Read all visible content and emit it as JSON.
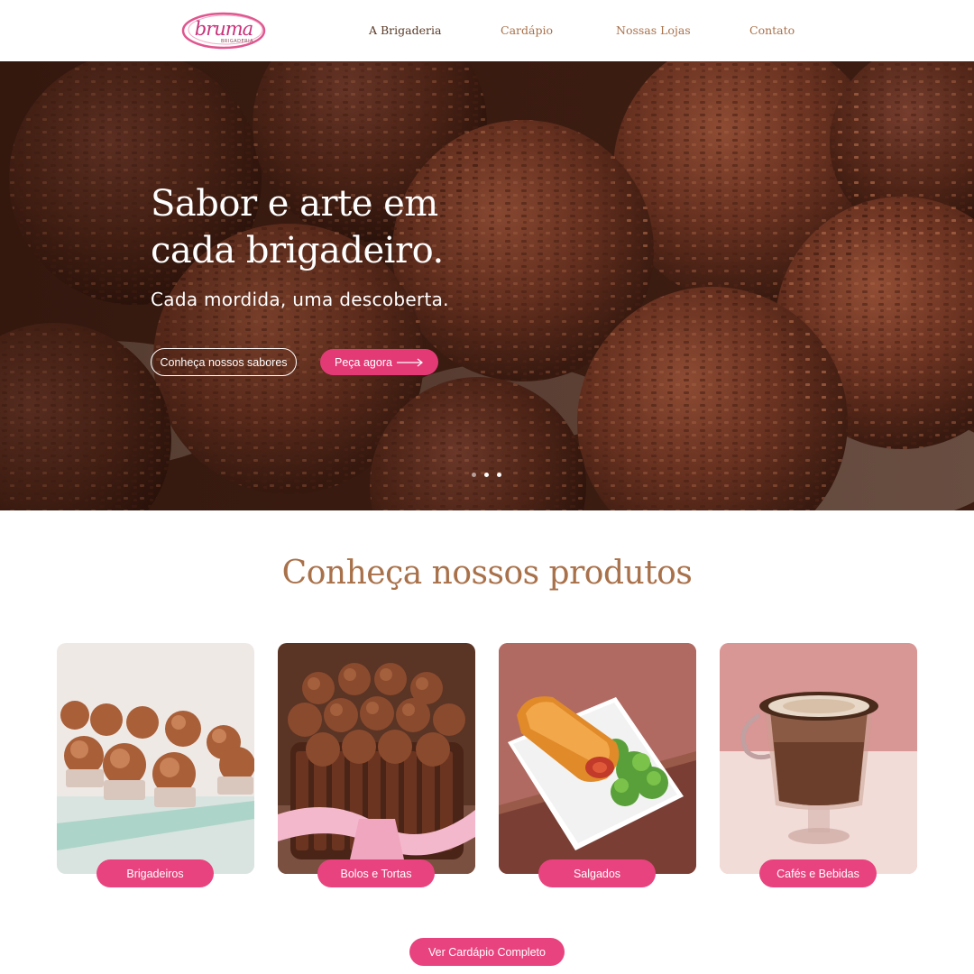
{
  "header": {
    "logo": {
      "name": "bruma",
      "sub": "BRIGADERIA"
    },
    "nav": [
      {
        "label": "A Brigaderia"
      },
      {
        "label": "Cardápio"
      },
      {
        "label": "Nossas Lojas"
      },
      {
        "label": "Contato"
      }
    ]
  },
  "hero": {
    "title": "Sabor e arte em cada brigadeiro.",
    "subtitle": "Cada mordida, uma descoberta.",
    "secondary_button": "Conheça nossos sabores",
    "primary_button": "Peça agora",
    "slides": {
      "count": 3
    }
  },
  "products": {
    "heading": "Conheça nossos produtos",
    "items": [
      {
        "label": "Brigadeiros"
      },
      {
        "label": "Bolos e Tortas"
      },
      {
        "label": "Salgados"
      },
      {
        "label": "Cafés e Bebidas"
      }
    ],
    "cta": "Ver Cardápio Completo"
  },
  "colors": {
    "accent_pink": "#e8437e",
    "heading_brown": "#a9714a",
    "nav_active": "#5a3a28"
  }
}
